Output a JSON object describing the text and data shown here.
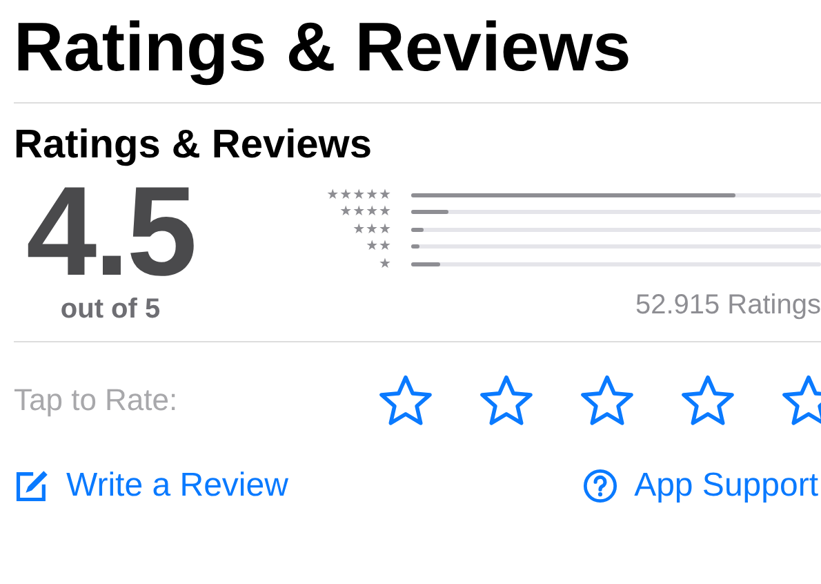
{
  "page_title": "Ratings & Reviews",
  "section_title": "Ratings & Reviews",
  "average": {
    "score": "4.5",
    "caption": "out of 5"
  },
  "histogram": [
    {
      "label": "★★★★★",
      "level": 0.79
    },
    {
      "label": "★★★★",
      "level": 0.09
    },
    {
      "label": "★★★",
      "level": 0.03
    },
    {
      "label": "★★",
      "level": 0.02
    },
    {
      "label": "★",
      "level": 0.07
    }
  ],
  "ratings_count": "52.915 Ratings",
  "tap_to_rate": {
    "label": "Tap to Rate:",
    "stars": 0
  },
  "links": [
    {
      "kind": "write",
      "label": "Write a Review"
    },
    {
      "kind": "support",
      "label": "App Support"
    }
  ]
}
